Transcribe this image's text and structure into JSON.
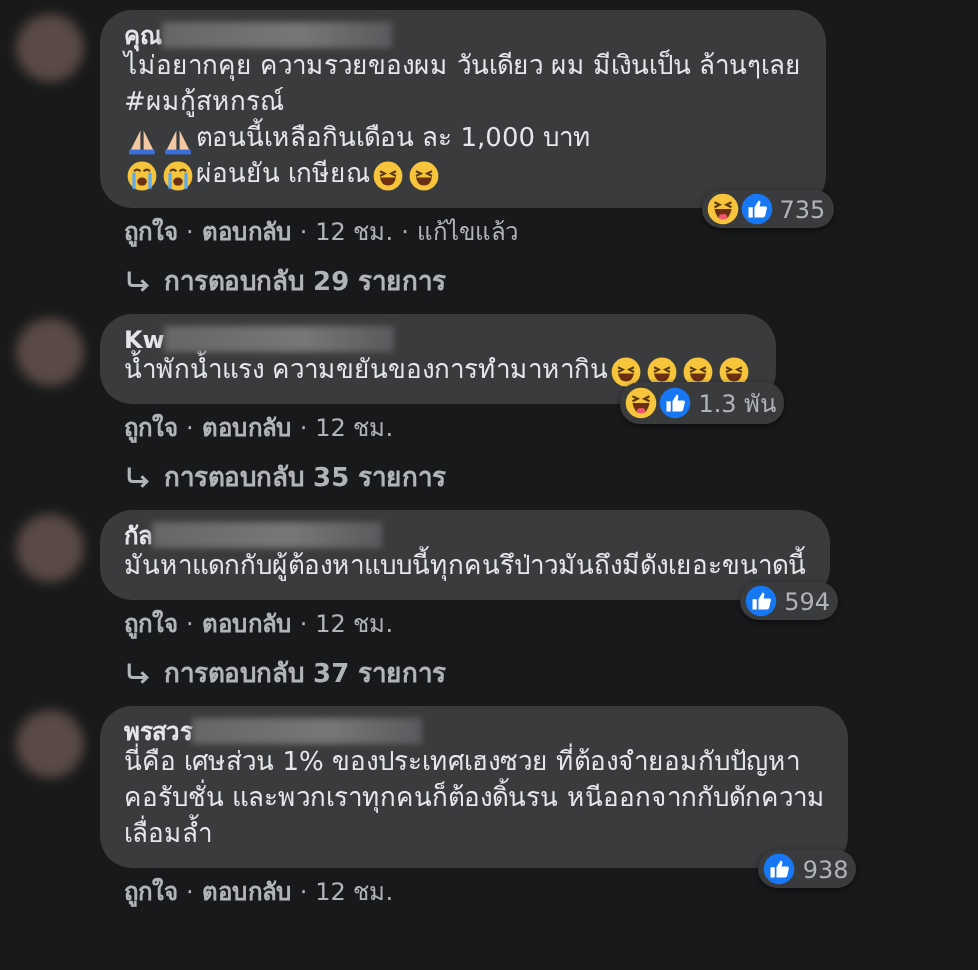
{
  "comments": [
    {
      "author": "คุณ",
      "name_blurred": true,
      "lines": [
        [
          {
            "kind": "text",
            "text": "ไม่อยากคุย ความรวยของผม วันเดียว ผม มีเงินเป็น ล้านๆเลย"
          }
        ],
        [
          {
            "kind": "text",
            "text": "#ผมกู้สหกรณ์"
          }
        ],
        [
          {
            "kind": "pray"
          },
          {
            "kind": "pray"
          },
          {
            "kind": "text",
            "text": "ตอนนี้เหลือกินเดือน ละ 1,000 บาท"
          }
        ],
        [
          {
            "kind": "cry"
          },
          {
            "kind": "cry"
          },
          {
            "kind": "text",
            "text": " ผ่อนยัน เกษียณ"
          },
          {
            "kind": "laugh"
          },
          {
            "kind": "laugh"
          }
        ]
      ],
      "reactions": [
        {
          "kind": "haha"
        },
        {
          "kind": "like"
        }
      ],
      "reaction_count": "735",
      "meta": [
        {
          "kind": "link",
          "text": "ถูกใจ"
        },
        {
          "kind": "sep",
          "text": "·"
        },
        {
          "kind": "link",
          "text": "ตอบกลับ"
        },
        {
          "kind": "sep",
          "text": "·"
        },
        {
          "kind": "info",
          "text": "12 ชม."
        },
        {
          "kind": "sep",
          "text": "·"
        },
        {
          "kind": "info",
          "text": "แก้ไขแล้ว"
        }
      ],
      "replies": "การตอบกลับ 29 รายการ"
    },
    {
      "author": "Kw",
      "name_blurred": true,
      "lines": [
        [
          {
            "kind": "text",
            "text": "น้ำพักน้ำแรง ความขยันของการทำมาหากิน "
          },
          {
            "kind": "laugh"
          },
          {
            "kind": "laugh"
          },
          {
            "kind": "laugh"
          },
          {
            "kind": "laugh"
          }
        ]
      ],
      "reactions": [
        {
          "kind": "haha"
        },
        {
          "kind": "like"
        }
      ],
      "reaction_count": "1.3 พัน",
      "meta": [
        {
          "kind": "link",
          "text": "ถูกใจ"
        },
        {
          "kind": "sep",
          "text": "·"
        },
        {
          "kind": "link",
          "text": "ตอบกลับ"
        },
        {
          "kind": "sep",
          "text": "·"
        },
        {
          "kind": "info",
          "text": "12 ชม."
        }
      ],
      "replies": "การตอบกลับ 35 รายการ"
    },
    {
      "author": "กัล",
      "name_blurred": true,
      "lines": [
        [
          {
            "kind": "text",
            "text": "มันหาแดกกับผู้ต้องหาแบบนี้ทุกคนรึป่าวมันถึงมีดังเยอะขนาดนี้"
          }
        ]
      ],
      "reactions": [
        {
          "kind": "like"
        }
      ],
      "reaction_count": "594",
      "meta": [
        {
          "kind": "link",
          "text": "ถูกใจ"
        },
        {
          "kind": "sep",
          "text": "·"
        },
        {
          "kind": "link",
          "text": "ตอบกลับ"
        },
        {
          "kind": "sep",
          "text": "·"
        },
        {
          "kind": "info",
          "text": "12 ชม."
        }
      ],
      "replies": "การตอบกลับ 37 รายการ"
    },
    {
      "author": "พรสวร",
      "name_blurred": true,
      "lines": [
        [
          {
            "kind": "text",
            "text": "นี่คือ เศษส่วน 1% ของประเทศเฮงซวย ที่ต้องจำยอมกับปัญหา"
          }
        ],
        [
          {
            "kind": "text",
            "text": "คอรับชั่น และพวกเราทุกคนก็ต้องดิ้นรน หนีออกจากกับดักความ"
          }
        ],
        [
          {
            "kind": "text",
            "text": "เลื่อมล้ำ"
          }
        ]
      ],
      "reactions": [
        {
          "kind": "like"
        }
      ],
      "reaction_count": "938",
      "meta": [
        {
          "kind": "link",
          "text": "ถูกใจ"
        },
        {
          "kind": "sep",
          "text": "·"
        },
        {
          "kind": "link",
          "text": "ตอบกลับ"
        },
        {
          "kind": "sep",
          "text": "·"
        },
        {
          "kind": "info",
          "text": "12 ชม."
        }
      ]
    }
  ]
}
